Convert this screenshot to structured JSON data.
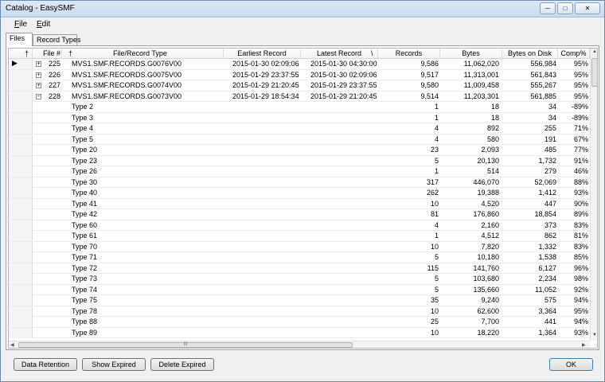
{
  "window": {
    "title": "Catalog - EasySMF",
    "minimize": "─",
    "maximize": "□",
    "close": "✕"
  },
  "menu": {
    "file_hotkey": "F",
    "file_rest": "ile",
    "edit_hotkey": "E",
    "edit_rest": "dit"
  },
  "tabs": [
    "Files",
    "Record Types"
  ],
  "grid": {
    "columns": [
      "File #",
      "File/Record Type",
      "Earliest Record",
      "Latest Record",
      "Records",
      "Bytes",
      "Bytes on Disk",
      "Comp%"
    ],
    "pin_glyph": "†",
    "sort_glyph": "\\",
    "files": [
      {
        "id": "225",
        "expanded": false,
        "current": true,
        "name": "MVS1.SMF.RECORDS.G0076V00",
        "earliest": "2015-01-30 02:09:06",
        "latest": "2015-01-30 04:30:00",
        "records": "9,586",
        "bytes": "11,062,020",
        "disk": "556,984",
        "comp": "95%"
      },
      {
        "id": "226",
        "expanded": false,
        "current": false,
        "name": "MVS1.SMF.RECORDS.G0075V00",
        "earliest": "2015-01-29 23:37:55",
        "latest": "2015-01-30 02:09:06",
        "records": "9,517",
        "bytes": "11,313,001",
        "disk": "561,843",
        "comp": "95%"
      },
      {
        "id": "227",
        "expanded": false,
        "current": false,
        "name": "MVS1.SMF.RECORDS.G0074V00",
        "earliest": "2015-01-29 21:20:45",
        "latest": "2015-01-29 23:37:55",
        "records": "9,580",
        "bytes": "11,009,458",
        "disk": "555,267",
        "comp": "95%"
      },
      {
        "id": "228",
        "expanded": true,
        "current": false,
        "name": "MVS1.SMF.RECORDS.G0073V00",
        "earliest": "2015-01-29 18:54:34",
        "latest": "2015-01-29 21:20:45",
        "records": "9,514",
        "bytes": "11,203,301",
        "disk": "561,885",
        "comp": "95%"
      }
    ],
    "types": [
      {
        "name": "Type 2",
        "records": "1",
        "bytes": "18",
        "disk": "34",
        "comp": "-89%"
      },
      {
        "name": "Type 3",
        "records": "1",
        "bytes": "18",
        "disk": "34",
        "comp": "-89%"
      },
      {
        "name": "Type 4",
        "records": "4",
        "bytes": "892",
        "disk": "255",
        "comp": "71%"
      },
      {
        "name": "Type 5",
        "records": "4",
        "bytes": "580",
        "disk": "191",
        "comp": "67%"
      },
      {
        "name": "Type 20",
        "records": "23",
        "bytes": "2,093",
        "disk": "485",
        "comp": "77%"
      },
      {
        "name": "Type 23",
        "records": "5",
        "bytes": "20,130",
        "disk": "1,732",
        "comp": "91%"
      },
      {
        "name": "Type 26",
        "records": "1",
        "bytes": "514",
        "disk": "279",
        "comp": "46%"
      },
      {
        "name": "Type 30",
        "records": "317",
        "bytes": "446,070",
        "disk": "52,069",
        "comp": "88%"
      },
      {
        "name": "Type 40",
        "records": "262",
        "bytes": "19,388",
        "disk": "1,412",
        "comp": "93%"
      },
      {
        "name": "Type 41",
        "records": "10",
        "bytes": "4,520",
        "disk": "447",
        "comp": "90%"
      },
      {
        "name": "Type 42",
        "records": "81",
        "bytes": "176,860",
        "disk": "18,854",
        "comp": "89%"
      },
      {
        "name": "Type 60",
        "records": "4",
        "bytes": "2,160",
        "disk": "373",
        "comp": "83%"
      },
      {
        "name": "Type 61",
        "records": "1",
        "bytes": "4,512",
        "disk": "862",
        "comp": "81%"
      },
      {
        "name": "Type 70",
        "records": "10",
        "bytes": "7,820",
        "disk": "1,332",
        "comp": "83%"
      },
      {
        "name": "Type 71",
        "records": "5",
        "bytes": "10,180",
        "disk": "1,538",
        "comp": "85%"
      },
      {
        "name": "Type 72",
        "records": "115",
        "bytes": "141,760",
        "disk": "6,127",
        "comp": "96%"
      },
      {
        "name": "Type 73",
        "records": "5",
        "bytes": "103,680",
        "disk": "2,234",
        "comp": "98%"
      },
      {
        "name": "Type 74",
        "records": "5",
        "bytes": "135,660",
        "disk": "11,052",
        "comp": "92%"
      },
      {
        "name": "Type 75",
        "records": "35",
        "bytes": "9,240",
        "disk": "575",
        "comp": "94%"
      },
      {
        "name": "Type 78",
        "records": "10",
        "bytes": "62,600",
        "disk": "3,364",
        "comp": "95%"
      },
      {
        "name": "Type 88",
        "records": "25",
        "bytes": "7,700",
        "disk": "441",
        "comp": "94%"
      },
      {
        "name": "Type 89",
        "records": "10",
        "bytes": "18,220",
        "disk": "1,364",
        "comp": "93%"
      }
    ],
    "hscroll_grip": "III"
  },
  "buttons": {
    "data_retention": "Data Retention",
    "show_expired": "Show Expired",
    "delete_expired": "Delete Expired",
    "ok": "OK"
  }
}
